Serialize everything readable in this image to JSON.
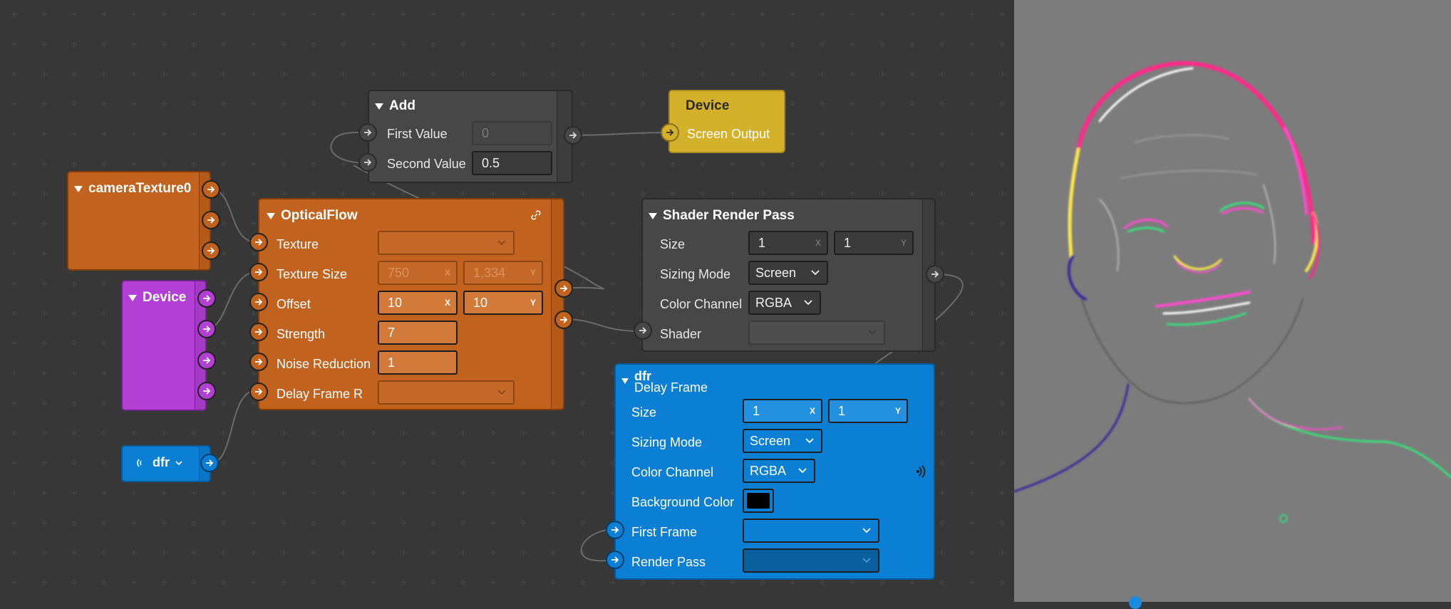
{
  "colors": {
    "canvas": "#373737",
    "orange": "#c1621e",
    "purple": "#b240d4",
    "blue": "#0b7fd4",
    "yellow": "#d4b12b",
    "gray_node": "#474747",
    "preview_bg": "#7c7c7c"
  },
  "add_node": {
    "title": "Add",
    "first_value_label": "First Value",
    "first_value": "0",
    "second_value_label": "Second Value",
    "second_value": "0.5"
  },
  "device_output": {
    "title": "Device",
    "port_label": "Screen Output"
  },
  "camera_node": {
    "title": "cameraTexture0"
  },
  "device_node": {
    "title": "Device"
  },
  "dfr_small": {
    "title": "dfr",
    "signal_icon": "broadcast-icon"
  },
  "optical_flow": {
    "title": "OpticalFlow",
    "link_icon": "link-icon",
    "texture_label": "Texture",
    "texture_size_label": "Texture Size",
    "texture_size_x": "750",
    "texture_size_y": "1,334",
    "offset_label": "Offset",
    "offset_x": "10",
    "offset_y": "10",
    "strength_label": "Strength",
    "strength": "7",
    "noise_label": "Noise Reduction",
    "noise": "1",
    "delay_label": "Delay Frame R",
    "axis_x": "X",
    "axis_y": "Y"
  },
  "shader_pass": {
    "title": "Shader Render Pass",
    "size_label": "Size",
    "size_x": "1",
    "size_y": "1",
    "sizing_label": "Sizing Mode",
    "sizing_value": "Screen",
    "channel_label": "Color Channel",
    "channel_value": "RGBA",
    "shader_label": "Shader",
    "axis_x": "X",
    "axis_y": "Y"
  },
  "delay_frame": {
    "title": "dfr",
    "subtitle": "Delay Frame",
    "size_label": "Size",
    "size_x": "1",
    "size_y": "1",
    "sizing_label": "Sizing Mode",
    "sizing_value": "Screen",
    "channel_label": "Color Channel",
    "channel_value": "RGBA",
    "bg_label": "Background Color",
    "first_frame_label": "First Frame",
    "render_pass_label": "Render Pass",
    "axis_x": "X",
    "axis_y": "Y",
    "signal_icon": "broadcast-icon"
  }
}
